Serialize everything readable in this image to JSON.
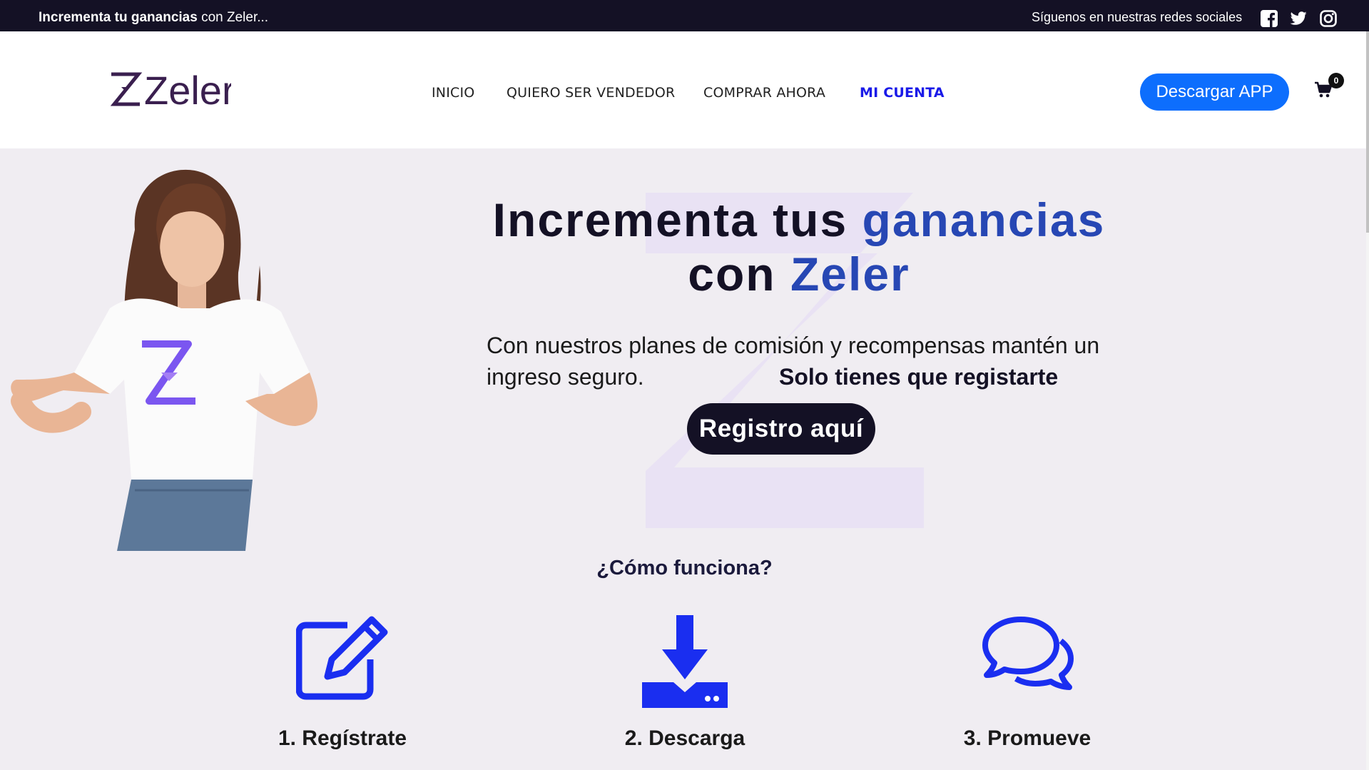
{
  "topbar": {
    "promo_bold": "Incrementa tu ganancias",
    "promo_rest": " con Zeler...",
    "social_label": "Síguenos en nuestras redes sociales",
    "social_icons": [
      "facebook-icon",
      "twitter-icon",
      "instagram-icon"
    ]
  },
  "header": {
    "logo_text": "Zeler",
    "nav": [
      "INICIO",
      "QUIERO SER VENDEDOR",
      "COMPRAR AHORA",
      "MI CUENTA"
    ],
    "active_nav": "MI CUENTA",
    "download_button": "Descargar APP",
    "cart_count": "0"
  },
  "hero": {
    "title_line1_a": "Increm",
    "title_line1_b": "enta tus ",
    "title_line1_accent": "ganancias",
    "title_line2_a": "con ",
    "title_line2_accent": "Zeler",
    "text": "Con nuestros planes de comisión y recompensas mantén un ingreso seguro.",
    "text_strong": "Solo tienes que registarte",
    "register_button": "Registro aquí"
  },
  "how": {
    "title": "¿Cómo funciona?",
    "steps": [
      {
        "label": "1. Regístrate",
        "icon": "edit-icon"
      },
      {
        "label": "2. Descarga",
        "icon": "download-icon"
      },
      {
        "label": "3. Promueve",
        "icon": "comments-icon"
      }
    ]
  },
  "colors": {
    "dark": "#141125",
    "accent_blue": "#2747b4",
    "button_blue": "#0d6efd",
    "icon_blue": "#1a2ef0",
    "nav_active": "#1a1ae8"
  }
}
